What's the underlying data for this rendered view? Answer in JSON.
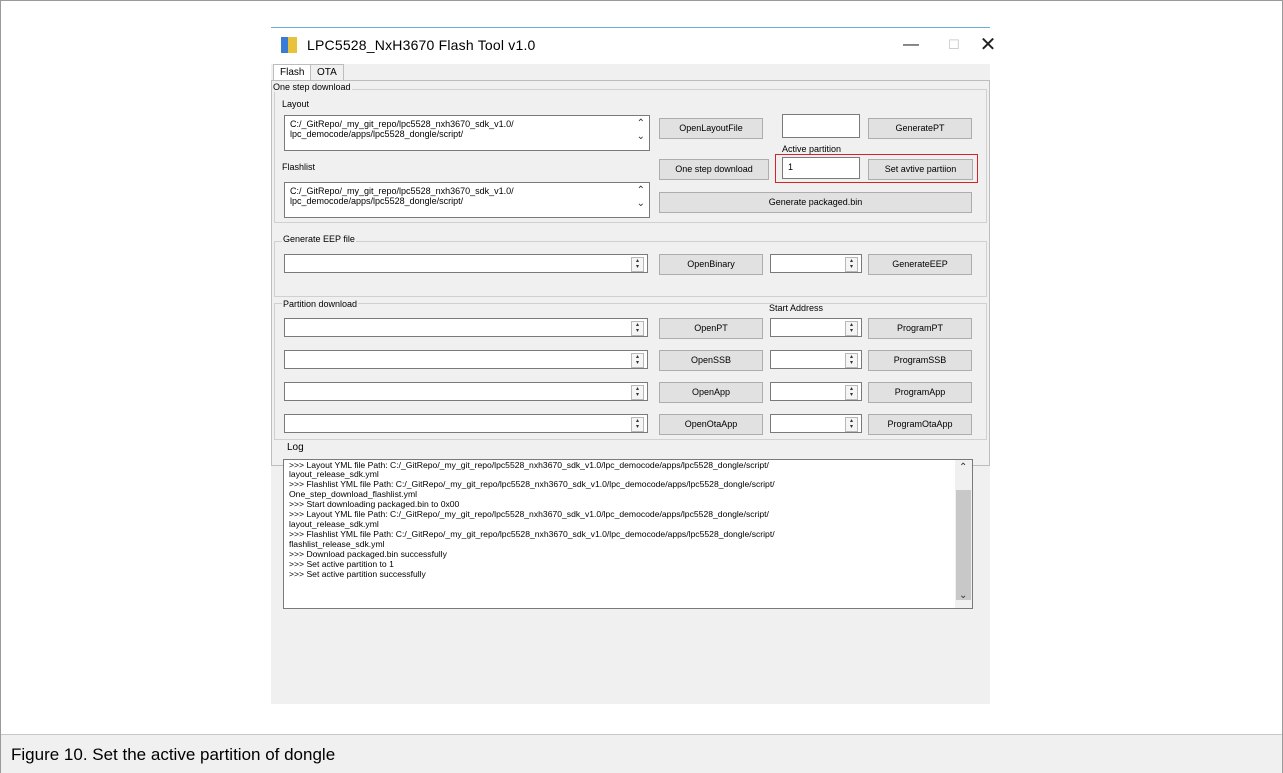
{
  "window": {
    "title": "LPC5528_NxH3670 Flash Tool v1.0",
    "min_symbol": "—",
    "max_symbol": "☐",
    "close_symbol": "✕"
  },
  "tabs": [
    {
      "label": "Flash",
      "active": true
    },
    {
      "label": "OTA",
      "active": false
    }
  ],
  "one_step": {
    "group_label": "One step download",
    "layout_label": "Layout",
    "layout_text_line1": "C:/_GitRepo/_my_git_repo/lpc5528_nxh3670_sdk_v1.0/",
    "layout_text_line2": "lpc_democode/apps/lpc5528_dongle/script/",
    "flashlist_label": "Flashlist",
    "flashlist_text_line1": "C:/_GitRepo/_my_git_repo/lpc5528_nxh3670_sdk_v1.0/",
    "flashlist_text_line2": "lpc_democode/apps/lpc5528_dongle/script/",
    "open_layout_button": "OpenLayoutFile",
    "generate_pt_button": "GeneratePT",
    "active_partition_label": "Active partition",
    "active_partition_value": "1",
    "one_step_button": "One step download",
    "set_active_button": "Set avtive partiion",
    "generate_packaged_button": "Generate packaged.bin"
  },
  "eep": {
    "group_label": "Generate EEP file",
    "open_binary_button": "OpenBinary",
    "generate_eep_button": "GenerateEEP"
  },
  "partition": {
    "group_label": "Partition download",
    "start_address_label": "Start Address",
    "rows": [
      {
        "open": "OpenPT",
        "program": "ProgramPT"
      },
      {
        "open": "OpenSSB",
        "program": "ProgramSSB"
      },
      {
        "open": "OpenApp",
        "program": "ProgramApp"
      },
      {
        "open": "OpenOtaApp",
        "program": "ProgramOtaApp"
      }
    ]
  },
  "log": {
    "label": "Log",
    "lines": [
      ">>> Layout YML file Path: C:/_GitRepo/_my_git_repo/lpc5528_nxh3670_sdk_v1.0/lpc_democode/apps/lpc5528_dongle/script/",
      "layout_release_sdk.yml",
      ">>> Flashlist YML file Path: C:/_GitRepo/_my_git_repo/lpc5528_nxh3670_sdk_v1.0/lpc_democode/apps/lpc5528_dongle/script/",
      "One_step_download_flashlist.yml",
      ">>> Start downloading packaged.bin to 0x00",
      ">>> Layout YML file Path: C:/_GitRepo/_my_git_repo/lpc5528_nxh3670_sdk_v1.0/lpc_democode/apps/lpc5528_dongle/script/",
      "layout_release_sdk.yml",
      ">>> Flashlist YML file Path: C:/_GitRepo/_my_git_repo/lpc5528_nxh3670_sdk_v1.0/lpc_democode/apps/lpc5528_dongle/script/",
      "flashlist_release_sdk.yml",
      ">>> Download packaged.bin successfully",
      ">>> Set active partition to 1",
      ">>> Set active partition successfully"
    ]
  },
  "figure_caption": "Figure 10.  Set the active partition of dongle",
  "colors": {
    "highlight": "#d0262a",
    "window_bg": "#f0f0f0",
    "button_bg": "#e1e1e1"
  }
}
